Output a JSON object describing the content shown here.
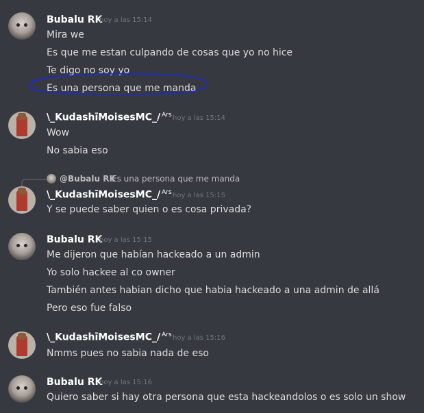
{
  "messages": [
    {
      "author": "Bubalu RK",
      "timestamp": "hoy a las 15:14",
      "lines": [
        "Mira we",
        "Es que me estan culpando de cosas que yo no hice",
        "Te digo no soy yo",
        "Es una persona que me manda"
      ]
    },
    {
      "author": "\\_KudashiiMoisesMC_/",
      "author_display": "\\_KudashīMoisesMC_/",
      "tag": "Ars",
      "timestamp": "hoy a las 15:14",
      "lines": [
        "Wow",
        "No sabia eso"
      ]
    },
    {
      "reply": {
        "mention": "@Bubalu RK",
        "text": "Es una persona que me manda"
      },
      "author": "\\_KudashīMoisesMC_/",
      "tag": "Ars",
      "timestamp": "hoy a las 15:15",
      "lines": [
        "Y se puede saber quien o es cosa privada?"
      ]
    },
    {
      "author": "Bubalu RK",
      "timestamp": "hoy a las 15:15",
      "lines": [
        "Me dijeron que habían hackeado a un admin",
        "Yo solo hackee al co owner",
        "También antes habian dicho que habia hackeado a una admin de allá",
        "Pero eso fue falso"
      ]
    },
    {
      "author": "\\_KudashīMoisesMC_/",
      "tag": "Ars",
      "timestamp": "hoy a las 15:16",
      "lines": [
        "Nmms pues no sabia nada de eso"
      ]
    },
    {
      "author": "Bubalu RK",
      "timestamp": "hoy a las 15:16",
      "lines": [
        "Quiero saber si hay otra persona que esta hackeandolos o es solo un show"
      ]
    }
  ],
  "colors": {
    "background": "#36393f",
    "username": "#ffffff",
    "text": "#dcddde",
    "timestamp": "#72767d",
    "annotation_circle": "#1a2bd6"
  }
}
